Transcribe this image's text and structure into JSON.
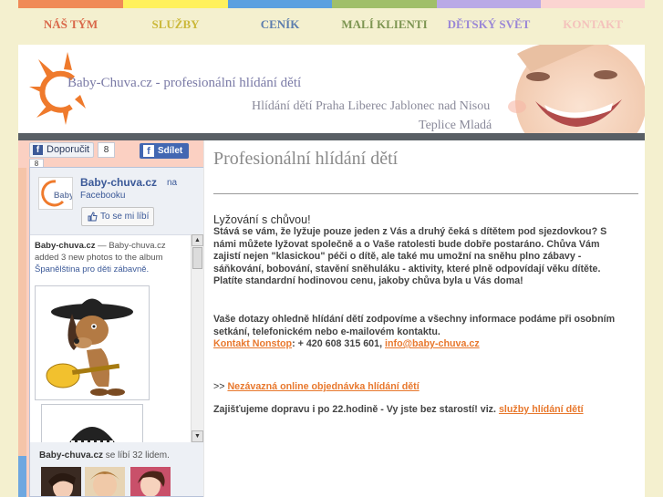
{
  "nav": [
    {
      "label": "NÁŠ TÝM",
      "bar": "#f08a57",
      "color": "#d9684a"
    },
    {
      "label": "SLUŽBY",
      "bar": "#fff15c",
      "color": "#cbb83a"
    },
    {
      "label": "CENÍK",
      "bar": "#5aa0e0",
      "color": "#5c7dae"
    },
    {
      "label": "MALÍ KLIENTI",
      "bar": "#a0bf69",
      "color": "#7d9552"
    },
    {
      "label": "DĚTSKÝ SVĚT",
      "bar": "#b9a9e6",
      "color": "#9a87d6"
    },
    {
      "label": "KONTAKT",
      "bar": "#fbd4d1",
      "color": "#f4c2bc"
    }
  ],
  "header": {
    "site_title": "Baby-Chuva.cz - profesionální hlídání dětí",
    "tagline_line1": "Hlídání dětí Praha Liberec Jablonec nad Nisou",
    "tagline_line2": "Teplice Mladá Boleslav"
  },
  "facebook": {
    "recommend_label": "Doporučit",
    "recommend_count": "8",
    "recommend_count_small": "8",
    "share_label": "Sdílet",
    "page_name": "Baby-chuva.cz",
    "page_suffix": "na",
    "page_suffix2": "Facebooku",
    "logo_text": "Baby",
    "like_button": "To se mi líbí",
    "feed_author": "Baby-chuva.cz",
    "feed_dash": " — ",
    "feed_author2": "Baby-chuva.cz",
    "feed_added": "added 3 new photos to the album",
    "feed_album": "Španělština pro děti zábavně.",
    "fans_name": "Baby-chuva.cz",
    "fans_text": " se líbí 32 lidem."
  },
  "main": {
    "title": "Profesionální hlídání dětí",
    "subhead": "Lyžování s chůvou!",
    "para1": "Stává se vám, že lyžuje pouze jeden z Vás a druhý čeká s dítětem pod sjezdovkou? S námi můžete lyžovat společně a o Vaše ratolesti bude dobře postaráno. Chůva Vám zajistí nejen \"klasickou\" péči o dítě, ale také mu umožní na sněhu plno zábavy - sáňkování, bobování, stavění sněhuláku - aktivity, které plně odpovídají věku dítěte. Platíte standardní hodinovou cenu, jakoby chůva byla u Vás doma!",
    "para2": "Vaše dotazy ohledně hlídání dětí zodpovíme a všechny informace podáme při osobním setkání, telefonickém nebo e-mailovém kontaktu.",
    "contact_link": "Kontakt Nonstop",
    "contact_phone": ": + 420 608 315 601, ",
    "contact_email": "info@baby-chuva.cz",
    "order_prefix": ">> ",
    "order_link": "Nezávazná online objednávka hlídání dětí",
    "transport_text": "Zajišťujeme dopravu i po 22.hodině - Vy jste bez starostí! viz. ",
    "transport_link": "služby hlídání dětí"
  }
}
